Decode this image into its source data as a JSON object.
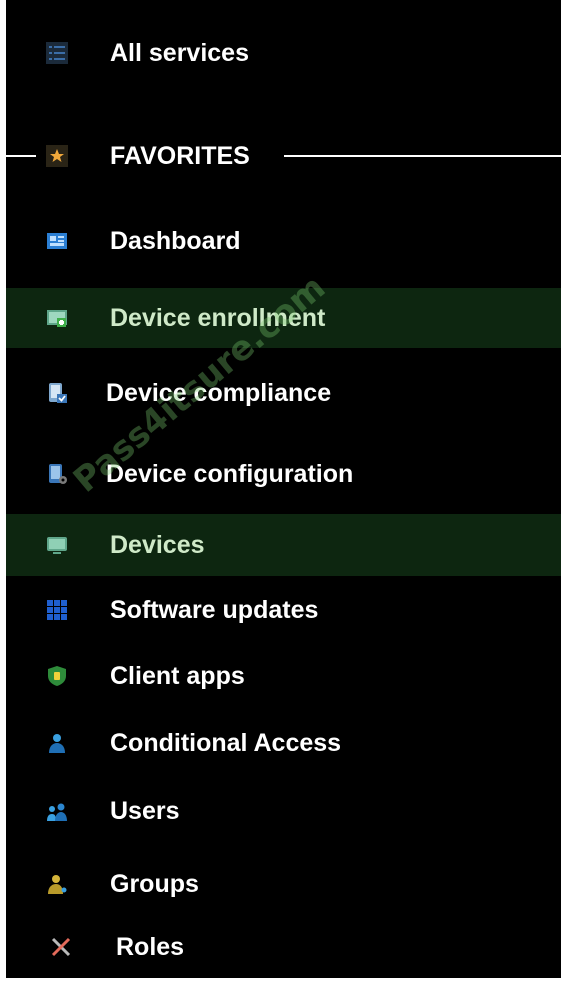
{
  "nav": {
    "all_services": {
      "label": "All services",
      "icon": "list-icon"
    },
    "favorites_label": "FAVORITES",
    "items": [
      {
        "label": "Dashboard",
        "icon": "dashboard-icon"
      },
      {
        "label": "Device enrollment",
        "icon": "device-enrollment-icon"
      },
      {
        "label": "Device compliance",
        "icon": "device-compliance-icon"
      },
      {
        "label": "Device configuration",
        "icon": "device-configuration-icon"
      },
      {
        "label": "Devices",
        "icon": "devices-icon"
      },
      {
        "label": "Software updates",
        "icon": "software-updates-icon"
      },
      {
        "label": "Client apps",
        "icon": "client-apps-icon"
      },
      {
        "label": "Conditional Access",
        "icon": "conditional-access-icon"
      },
      {
        "label": "Users",
        "icon": "users-icon"
      },
      {
        "label": "Groups",
        "icon": "groups-icon"
      },
      {
        "label": "Roles",
        "icon": "roles-icon"
      }
    ]
  },
  "watermark": "Pass4itsure.com",
  "colors": {
    "background": "#000000",
    "highlight": "#0d2610",
    "text": "#ffffff",
    "star": "#f2a93b",
    "icon_blue": "#2b7fd4"
  }
}
